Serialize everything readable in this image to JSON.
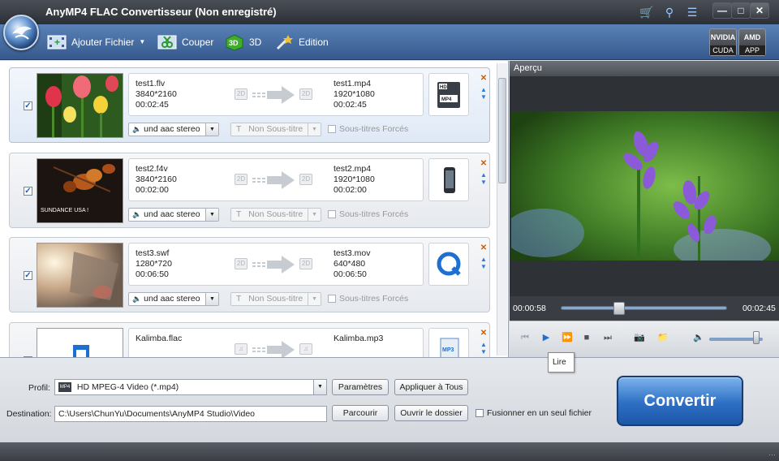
{
  "app": {
    "title": "AnyMP4 FLAC Convertisseur (Non enregistré)"
  },
  "toolbar": {
    "add_file": "Ajouter Fichier",
    "cut": "Couper",
    "three_d": "3D",
    "edit": "Edition"
  },
  "gpu": {
    "nvidia_top": "NVIDIA",
    "nvidia_label": "CUDA",
    "amd_top": "AMD",
    "amd_label": "APP"
  },
  "files": [
    {
      "name": "test1.flv",
      "resolution": "3840*2160",
      "duration": "00:02:45",
      "out_name": "test1.mp4",
      "out_resolution": "1920*1080",
      "out_duration": "00:02:45",
      "audio": "und aac stereo",
      "subtitle": "Non Sous-titre",
      "forced": "Sous-titres Forcés",
      "tag_in": "2D",
      "tag_out": "2D",
      "device_icon": "hd-mp4-icon"
    },
    {
      "name": "test2.f4v",
      "resolution": "3840*2160",
      "duration": "00:02:00",
      "out_name": "test2.mp4",
      "out_resolution": "1920*1080",
      "out_duration": "00:02:00",
      "audio": "und aac stereo",
      "subtitle": "Non Sous-titre",
      "forced": "Sous-titres Forcés",
      "tag_in": "2D",
      "tag_out": "2D",
      "device_icon": "phone-icon",
      "thumb_caption": "SUNDANCE USA !"
    },
    {
      "name": "test3.swf",
      "resolution": "1280*720",
      "duration": "00:06:50",
      "out_name": "test3.mov",
      "out_resolution": "640*480",
      "out_duration": "00:06:50",
      "audio": "und aac stereo",
      "subtitle": "Non Sous-titre",
      "forced": "Sous-titres Forcés",
      "tag_in": "2D",
      "tag_out": "2D",
      "device_icon": "quicktime-icon"
    },
    {
      "name": "Kalimba.flac",
      "resolution": "",
      "duration": "",
      "out_name": "Kalimba.mp3",
      "out_resolution": "",
      "out_duration": "",
      "audio": "",
      "subtitle": "",
      "forced": "",
      "tag_in": "♫",
      "tag_out": "♫",
      "device_icon": "mp3-icon"
    }
  ],
  "preview": {
    "header": "Aperçu",
    "time_current": "00:00:58",
    "time_total": "00:02:45",
    "seek_position": 0.35,
    "volume_level": 0.88,
    "tooltip": "Lire"
  },
  "bottom": {
    "profile_label": "Profil:",
    "profile_value": "HD MPEG-4 Video (*.mp4)",
    "params_button": "Paramètres",
    "apply_all_button": "Appliquer à Tous",
    "destination_label": "Destination:",
    "destination_value": "C:\\Users\\ChunYu\\Documents\\AnyMP4 Studio\\Video",
    "browse_button": "Parcourir",
    "open_folder_button": "Ouvrir le dossier",
    "merge_label": "Fusionner en un seul fichier",
    "convert_button": "Convertir"
  }
}
